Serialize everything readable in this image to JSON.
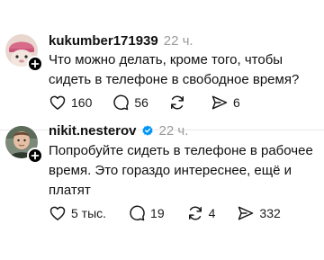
{
  "posts": [
    {
      "username": "kukumber171939",
      "timestamp": "22 ч.",
      "text": "Что можно делать, кроме того, чтобы сидеть в телефоне в свободное время?",
      "likes": "160",
      "replies": "56",
      "reposts": "",
      "shares": "6"
    },
    {
      "username": "nikit.nesterov",
      "timestamp": "22 ч.",
      "text": "Попробуйте сидеть в телефоне в рабочее время. Это гораздо интереснее, ещё и платят",
      "likes": "5 тыс.",
      "replies": "19",
      "reposts": "4",
      "shares": "332"
    }
  ],
  "icons": {
    "like": "heart-icon",
    "reply": "comment-icon",
    "repost": "repost-icon",
    "share": "send-icon",
    "follow": "plus-icon",
    "verified": "verified-badge-icon"
  },
  "colors": {
    "verified": "#0095f6",
    "muted": "#9a9a9a"
  }
}
